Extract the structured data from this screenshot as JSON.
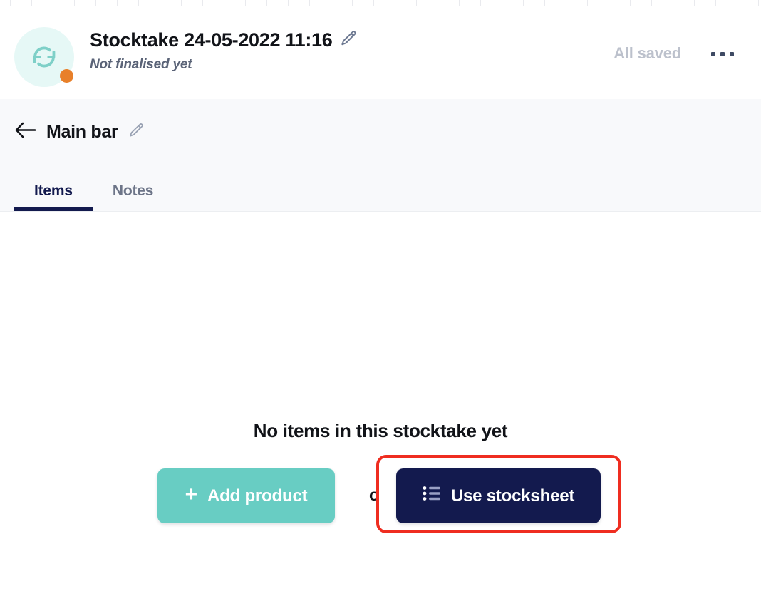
{
  "topbar": {
    "sync_icon": "sync-icon",
    "status_badge_color": "#e8802a",
    "avatar_bg": "#e6f8f6",
    "title": "Stocktake 24-05-2022 11:16",
    "title_edit_icon": "pencil-icon",
    "subtitle": "Not finalised yet",
    "save_status": "All saved",
    "menu_icon": "ellipsis-icon"
  },
  "subheader": {
    "back_icon": "arrow-left-icon",
    "location_name": "Main bar",
    "location_edit_icon": "pencil-icon",
    "tabs": [
      {
        "label": "Items",
        "active": true
      },
      {
        "label": "Notes",
        "active": false
      }
    ]
  },
  "empty_state": {
    "message": "No items in this stocktake yet",
    "add_product_label": "Add product",
    "add_product_icon": "plus-icon",
    "or_label": "or",
    "use_stocksheet_label": "Use stocksheet",
    "use_stocksheet_icon": "list-icon"
  },
  "colors": {
    "brand_navy": "#131a4e",
    "brand_teal": "#68cdc3",
    "accent_orange": "#e8802a",
    "highlight_red": "#ef2d20",
    "muted_text": "#bcc1cc",
    "panel_bg": "#f8f9fb"
  }
}
